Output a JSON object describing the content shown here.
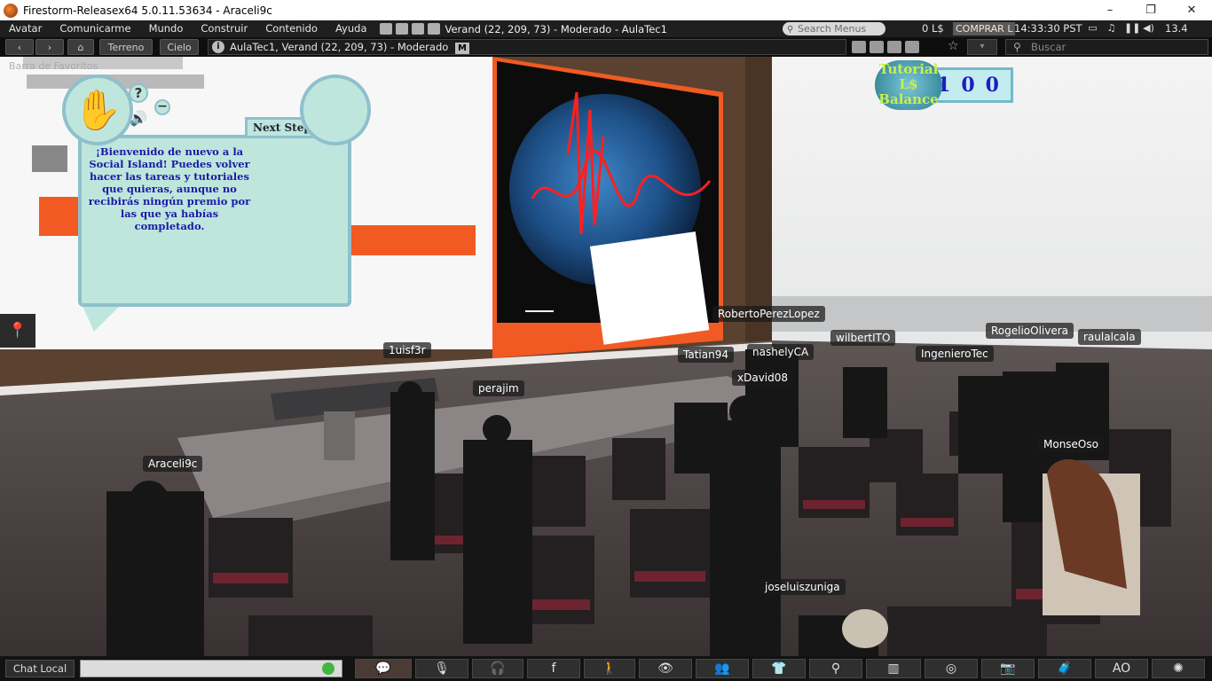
{
  "window": {
    "title": "Firestorm-Releasex64 5.0.11.53634 - Araceli9c",
    "minimize": "–",
    "restore": "❐",
    "close": "✕"
  },
  "menubar": {
    "items": [
      "Avatar",
      "Comunicarme",
      "Mundo",
      "Construir",
      "Contenido",
      "Ayuda"
    ],
    "location": "Verand (22, 209, 73) - Moderado - AulaTec1",
    "search_placeholder": "Search Menus",
    "balance": "0 L$",
    "buy": "COMPRAR L",
    "clock": "14:33:30 PST",
    "fps": "13.4"
  },
  "navbar": {
    "back": "‹",
    "forward": "›",
    "home": "⌂",
    "terrain": "Terreno",
    "sky": "Cielo",
    "location": "AulaTec1, Verand (22, 209, 73) - Moderado",
    "rating_badge": "M",
    "search_placeholder": "Buscar"
  },
  "viewport": {
    "favorites_label": "Barra de Favoritos"
  },
  "tutorial_hud": {
    "help": "?",
    "minimize": "−",
    "next_step": "Next Step",
    "message": "¡Bienvenido de nuevo a la Social Island! Puedes volver hacer las tareas y tutoriales que quieras, aunque no recibirás ningún premio por las que ya habías completado."
  },
  "balance_hud": {
    "title": "Tutorial L$ Balance",
    "value": "100"
  },
  "avatars": [
    {
      "name": "Araceli9c"
    },
    {
      "name": "1uisf3r"
    },
    {
      "name": "perajim"
    },
    {
      "name": "Tatian94"
    },
    {
      "name": "RobertoPerezLopez"
    },
    {
      "name": "nashelyCA"
    },
    {
      "name": "xDavid08"
    },
    {
      "name": "wilbertITO"
    },
    {
      "name": "IngenieroTec"
    },
    {
      "name": "RogelioOlivera"
    },
    {
      "name": "raulalcala"
    },
    {
      "name": "MonseOso"
    },
    {
      "name": "joseluiszuniga"
    }
  ],
  "bottombar": {
    "chat_local": "Chat Local",
    "ao_label": "AO"
  },
  "colors": {
    "hud_panel": "#bfe6dc",
    "hud_border": "#8ec0cc",
    "hud_text": "#1a1aa6",
    "slide_orange": "#f15a22"
  }
}
